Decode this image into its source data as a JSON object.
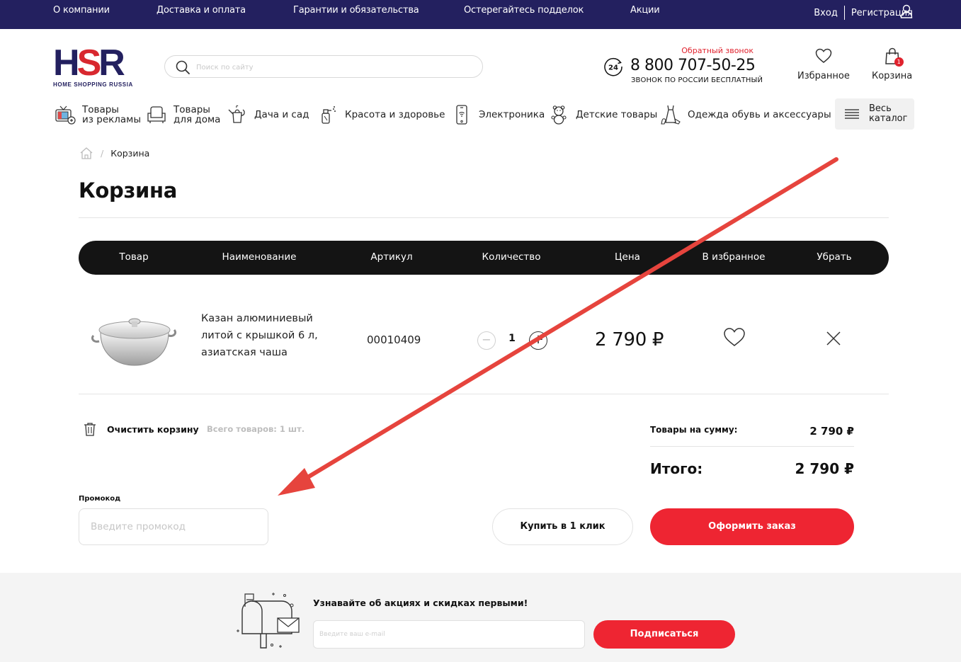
{
  "topnav": {
    "links": [
      "О компании",
      "Доставка и оплата",
      "Гарантии и обязательства",
      "Остерегайтесь подделок",
      "Акции"
    ],
    "login": "Вход",
    "register": "Регистрация"
  },
  "logo": {
    "mark_left": "H",
    "mark_o": "S",
    "mark_right": "R",
    "sub": "HOME SHOPPING RUSSIA"
  },
  "search": {
    "placeholder": "Поиск по сайту"
  },
  "contact": {
    "callback": "Обратный звонок",
    "icon_label": "24",
    "phone": "8 800 707-50-25",
    "note": "ЗВОНОК ПО РОССИИ БЕСПЛАТНЫЙ"
  },
  "header": {
    "favorites": "Избранное",
    "cart": "Корзина",
    "cart_count": "1"
  },
  "categories": [
    {
      "line1": "Товары",
      "line2": "из рекламы"
    },
    {
      "line1": "Товары",
      "line2": "для дома"
    },
    {
      "line1": "Дача и сад",
      "line2": ""
    },
    {
      "line1": "Красота и здоровье",
      "line2": ""
    },
    {
      "line1": "Электроника",
      "line2": ""
    },
    {
      "line1": "Детские товары",
      "line2": ""
    },
    {
      "line1": "Одежда обувь и аксессуары",
      "line2": ""
    }
  ],
  "catalog_btn": {
    "line1": "Весь",
    "line2": "каталог"
  },
  "breadcrumb": {
    "current": "Корзина"
  },
  "page_title": "Корзина",
  "table": {
    "headers": [
      "Товар",
      "Наименование",
      "Артикул",
      "Количество",
      "Цена",
      "В избранное",
      "Убрать"
    ]
  },
  "item": {
    "name": "Казан алюминиевый литой с крышкой 6 л, азиатская чаша",
    "sku": "00010409",
    "qty": "1",
    "price": "2 790 ₽"
  },
  "cart_footer": {
    "clear": "Очистить корзину",
    "total_count": "Всего товаров: 1 шт.",
    "sum_label": "Товары на сумму:",
    "sum_value": "2 790 ₽",
    "grand_label": "Итого:",
    "grand_value": "2 790 ₽"
  },
  "promo": {
    "label": "Промокод",
    "placeholder": "Введите промокод"
  },
  "buttons": {
    "one_click": "Купить в 1 клик",
    "checkout": "Оформить заказ"
  },
  "subscribe": {
    "title": "Узнавайте об акциях и скидках первыми!",
    "placeholder": "Введите ваш e-mail",
    "button": "Подписаться"
  },
  "colors": {
    "topbar": "#23205f",
    "accent_red": "#ee2532",
    "table_header": "#141414"
  }
}
